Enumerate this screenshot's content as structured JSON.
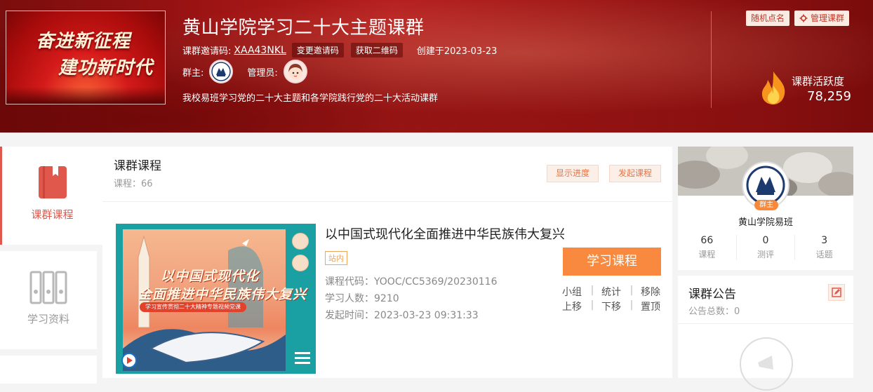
{
  "header": {
    "cover_line1": "奋进新征程",
    "cover_line2": "建功新时代",
    "title": "黄山学院学习二十大主题课群",
    "invite_label": "课群邀请码:",
    "invite_code": "XAA43NKL",
    "change_invite": "变更邀请码",
    "get_qr": "获取二维码",
    "created": "创建于2023-03-23",
    "owner_label": "群主:",
    "admin_label": "管理员:",
    "description": "我校易班学习党的二十大主题和各学院践行党的二十大活动课群",
    "random_call": "随机点名",
    "manage": "管理课群",
    "activity_label": "课群活跃度",
    "activity_value": "78,259"
  },
  "sidebar": {
    "items": [
      {
        "label": "课群课程",
        "icon": "book-icon"
      },
      {
        "label": "学习资料",
        "icon": "binders-icon"
      }
    ]
  },
  "main": {
    "title": "课群课程",
    "count": "课程：66",
    "show_progress": "显示进度",
    "start_course": "发起课程",
    "course": {
      "cover_line1": "以中国式现代化",
      "cover_line2": "全面推进中华民族伟大复兴",
      "cover_ribbon": "学习宣传贯彻二十大精神专题视频党课",
      "title": "以中国式现代化全面推进中华民族伟大复兴",
      "tag": "站内",
      "code": "课程代码：YOOC/CC5369/20230116",
      "students": "学习人数：9210",
      "start_time": "发起时间：2023-03-23 09:31:33",
      "study_button": "学习课程",
      "actions_row1": [
        "小组",
        "统计",
        "移除"
      ],
      "actions_row2": [
        "上移",
        "下移",
        "置顶"
      ]
    }
  },
  "profile": {
    "badge": "群主",
    "name": "黄山学院易班",
    "stats": [
      {
        "value": "66",
        "label": "课程"
      },
      {
        "value": "0",
        "label": "测评"
      },
      {
        "value": "3",
        "label": "话题"
      }
    ]
  },
  "notice": {
    "title": "课群公告",
    "count": "公告总数：0"
  }
}
